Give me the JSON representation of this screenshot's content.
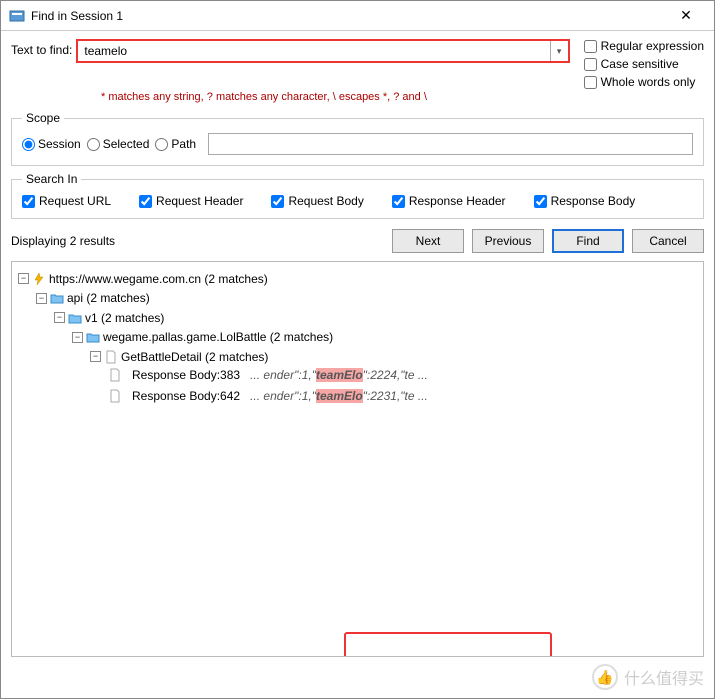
{
  "window": {
    "title": "Find in Session 1"
  },
  "find": {
    "label": "Text to find:",
    "value": "teamelo",
    "hint": "* matches any string, ? matches any character, \\ escapes *, ? and \\"
  },
  "options": {
    "regex": {
      "label": "Regular expression",
      "checked": false
    },
    "case": {
      "label": "Case sensitive",
      "checked": false
    },
    "whole": {
      "label": "Whole words only",
      "checked": false
    }
  },
  "scope": {
    "legend": "Scope",
    "session": "Session",
    "selected": "Selected",
    "path": "Path",
    "selectedValue": "session",
    "pathValue": ""
  },
  "searchIn": {
    "legend": "Search In",
    "requestUrl": {
      "label": "Request URL",
      "checked": true
    },
    "requestHeader": {
      "label": "Request Header",
      "checked": true
    },
    "requestBody": {
      "label": "Request Body",
      "checked": true
    },
    "responseHeader": {
      "label": "Response Header",
      "checked": true
    },
    "responseBody": {
      "label": "Response Body",
      "checked": true
    }
  },
  "results": {
    "text": "Displaying 2 results"
  },
  "buttons": {
    "next": "Next",
    "previous": "Previous",
    "find": "Find",
    "cancel": "Cancel"
  },
  "tree": {
    "root": {
      "label": "https://www.wegame.com.cn (2 matches)"
    },
    "api": {
      "label": "api (2 matches)"
    },
    "v1": {
      "label": "v1 (2 matches)"
    },
    "pallas": {
      "label": "wegame.pallas.game.LolBattle (2 matches)"
    },
    "detail": {
      "label": "GetBattleDetail (2 matches)"
    },
    "match1": {
      "label": "Response Body:383",
      "pre": "... ender\":1,\"",
      "hi": "teamElo",
      "post": "\":2224,\"te ..."
    },
    "match2": {
      "label": "Response Body:642",
      "pre": "... ender\":1,\"",
      "hi": "teamElo",
      "post": "\":2231,\"te ..."
    }
  },
  "watermark": {
    "text": "什么值得买"
  }
}
